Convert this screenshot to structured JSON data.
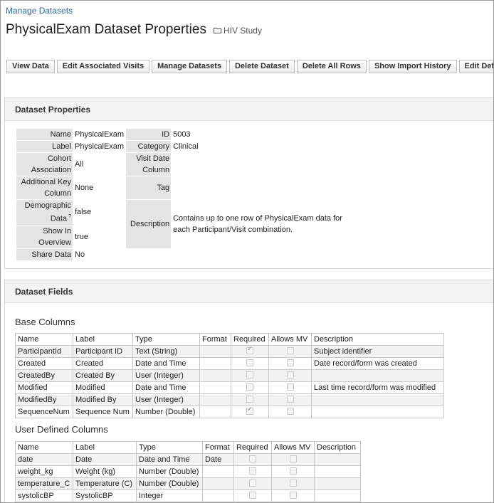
{
  "breadcrumb": "Manage Datasets",
  "page_title": "PhysicalExam Dataset Properties",
  "folder": "HIV Study",
  "toolbar": [
    "View Data",
    "Edit Associated Visits",
    "Manage Datasets",
    "Delete Dataset",
    "Delete All Rows",
    "Show Import History",
    "Edit Definition"
  ],
  "props_panel": {
    "title": "Dataset Properties",
    "left": [
      {
        "label": "Name",
        "value": "PhysicalExam"
      },
      {
        "label": "Label",
        "value": "PhysicalExam"
      },
      {
        "label": "Cohort Association",
        "value": "All"
      },
      {
        "label": "Additional Key Column",
        "value": "None"
      },
      {
        "label": "Demographic Data",
        "sup": "?",
        "value": "false"
      },
      {
        "label": "Show In Overview",
        "value": "true"
      },
      {
        "label": "Share Data",
        "value": "No"
      }
    ],
    "right": [
      {
        "label": "ID",
        "value": "5003"
      },
      {
        "label": "Category",
        "value": "Clinical"
      },
      {
        "label": "Visit Date Column",
        "value": ""
      },
      {
        "label": "Tag",
        "value": ""
      },
      {
        "label": "Description",
        "value": "Contains up to one row of PhysicalExam data for each Participant/Visit combination."
      }
    ]
  },
  "fields_panel": {
    "title": "Dataset Fields",
    "base_title": "Base Columns",
    "user_title": "User Defined Columns",
    "headers": [
      "Name",
      "Label",
      "Type",
      "Format",
      "Required",
      "Allows MV",
      "Description"
    ],
    "base_rows": [
      {
        "name": "ParticipantId",
        "label": "Participant ID",
        "type": "Text (String)",
        "format": "",
        "required": true,
        "mv": false,
        "desc": "Subject identifier"
      },
      {
        "name": "Created",
        "label": "Created",
        "type": "Date and Time",
        "format": "",
        "required": false,
        "mv": false,
        "desc": "Date record/form was created"
      },
      {
        "name": "CreatedBy",
        "label": "Created By",
        "type": "User (Integer)",
        "format": "",
        "required": false,
        "mv": false,
        "desc": ""
      },
      {
        "name": "Modified",
        "label": "Modified",
        "type": "Date and Time",
        "format": "",
        "required": false,
        "mv": false,
        "desc": "Last time record/form was modified"
      },
      {
        "name": "ModifiedBy",
        "label": "Modified By",
        "type": "User (Integer)",
        "format": "",
        "required": false,
        "mv": false,
        "desc": ""
      },
      {
        "name": "SequenceNum",
        "label": "Sequence Num",
        "type": "Number (Double)",
        "format": "",
        "required": true,
        "mv": false,
        "desc": ""
      }
    ],
    "user_rows": [
      {
        "name": "date",
        "label": "Date",
        "type": "Date and Time",
        "format": "Date",
        "required": false,
        "mv": false,
        "desc": ""
      },
      {
        "name": "weight_kg",
        "label": "Weight (kg)",
        "type": "Number (Double)",
        "format": "",
        "required": false,
        "mv": false,
        "desc": ""
      },
      {
        "name": "temperature_C",
        "label": "Temperature (C)",
        "type": "Number (Double)",
        "format": "",
        "required": false,
        "mv": false,
        "desc": ""
      },
      {
        "name": "systolicBP",
        "label": "SystolicBP",
        "type": "Integer",
        "format": "",
        "required": false,
        "mv": false,
        "desc": ""
      }
    ]
  }
}
